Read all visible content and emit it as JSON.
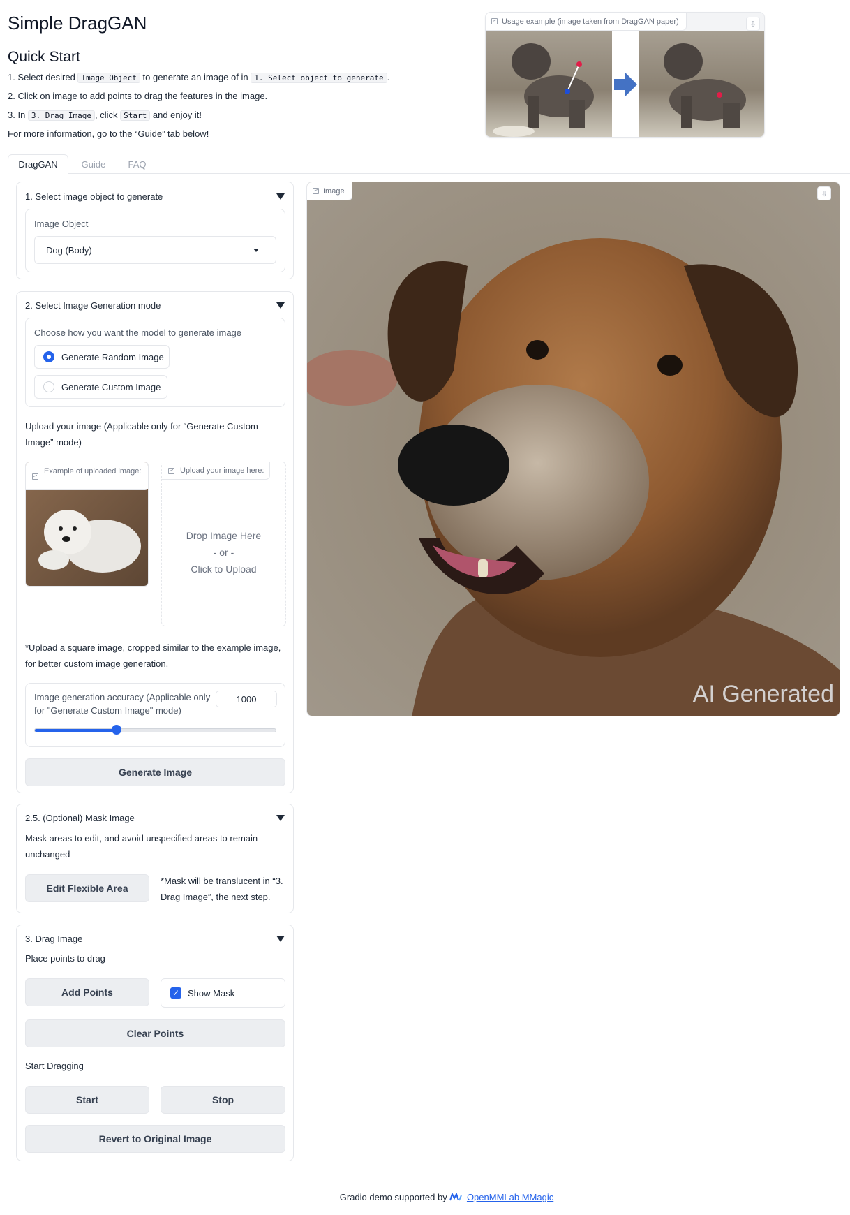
{
  "app": {
    "title": "Simple DragGAN"
  },
  "quickstart": {
    "heading": "Quick Start",
    "l1a": "1. Select desired ",
    "l1code1": "Image Object",
    "l1b": " to generate an image of in ",
    "l1code2": "1. Select object to generate",
    "l1c": ".",
    "l2": "2. Click on image to add points to drag the features in the image.",
    "l3a": "3. In ",
    "l3code1": "3. Drag Image",
    "l3b": ", click ",
    "l3code2": "Start",
    "l3c": " and enjoy it!",
    "l4": "For more information, go to the “Guide” tab below!"
  },
  "usage_example": {
    "label": "Usage example (image taken from DragGAN paper)"
  },
  "tabs": [
    "DragGAN",
    "Guide",
    "FAQ"
  ],
  "section1": {
    "title": "1. Select image object to generate",
    "field_label": "Image Object",
    "selected": "Dog (Body)"
  },
  "section2": {
    "title": "2. Select Image Generation mode",
    "radio_label": "Choose how you want the model to generate image",
    "options": [
      "Generate Random Image",
      "Generate Custom Image"
    ],
    "selected_index": 0,
    "upload_hint": "Upload your image (Applicable only for “Generate Custom Image” mode)",
    "example_label": "Example of uploaded image:",
    "upload_label": "Upload your image here:",
    "drop_text": "Drop Image Here",
    "or_text": "- or -",
    "click_text": "Click to Upload",
    "note": "*Upload a square image, cropped similar to the example image, for better custom image generation.",
    "accuracy_label": "Image generation accuracy (Applicable only for \"Generate Custom Image\" mode)",
    "accuracy_value": "1000",
    "slider_fraction": 0.34,
    "generate_button": "Generate Image"
  },
  "section25": {
    "title": "2.5. (Optional) Mask Image",
    "desc": "Mask areas to edit, and avoid unspecified areas to remain unchanged",
    "button": "Edit Flexible Area",
    "note": "*Mask will be translucent in “3. Drag Image”, the next step."
  },
  "section3": {
    "title": "3. Drag Image",
    "place_label": "Place points to drag",
    "add_points": "Add Points",
    "show_mask": "Show Mask",
    "show_mask_checked": true,
    "clear_points": "Clear Points",
    "start_label": "Start Dragging",
    "start": "Start",
    "stop": "Stop",
    "revert": "Revert to Original Image"
  },
  "image_panel": {
    "label": "Image",
    "watermark": "AI Generated"
  },
  "footer": {
    "text": "Gradio demo supported by ",
    "link": "OpenMMLab MMagic"
  },
  "colors": {
    "accent": "#2563eb",
    "border": "#e5e7eb",
    "button_bg": "#eceef1"
  }
}
